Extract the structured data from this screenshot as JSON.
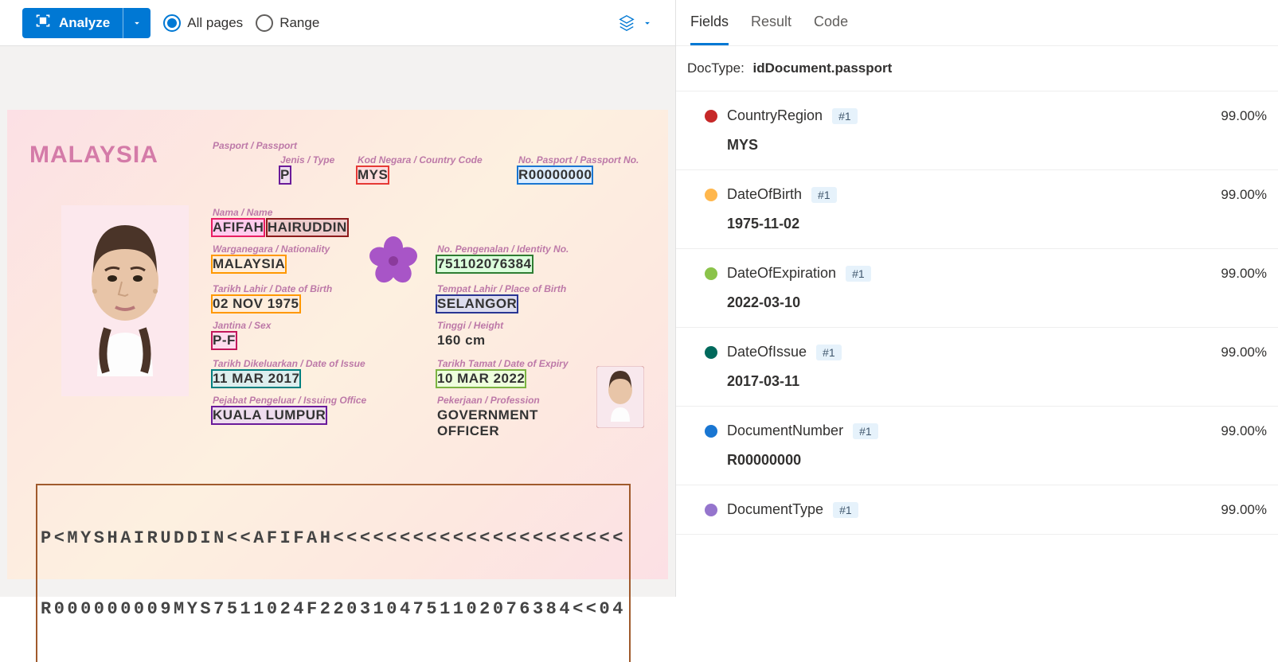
{
  "toolbar": {
    "analyze_label": "Analyze",
    "all_pages_label": "All pages",
    "range_label": "Range"
  },
  "passport": {
    "country_title": "MALAYSIA",
    "labels": {
      "passport": "Pasport / Passport",
      "type": "Jenis / Type",
      "country_code": "Kod Negara / Country Code",
      "passport_no": "No. Pasport / Passport No.",
      "name": "Nama / Name",
      "nationality": "Warganegara / Nationality",
      "identity": "No. Pengenalan / Identity No.",
      "dob": "Tarikh Lahir / Date of Birth",
      "pob": "Tempat Lahir / Place of Birth",
      "sex": "Jantina / Sex",
      "height": "Tinggi / Height",
      "doi": "Tarikh Dikeluarkan / Date of Issue",
      "doe": "Tarikh Tamat / Date of Expiry",
      "office": "Pejabat Pengeluar / Issuing Office",
      "profession": "Pekerjaan / Profession"
    },
    "type_val": "P",
    "country_code_val": "MYS",
    "passport_no_val": "R00000000",
    "first_name": "AFIFAH",
    "last_name": "HAIRUDDIN",
    "nationality": "MALAYSIA",
    "identity_no": "751102076384",
    "dob": "02 NOV 1975",
    "pob": "SELANGOR",
    "sex": "P-F",
    "height": "160 cm",
    "doi": "11 MAR 2017",
    "doe": "10 MAR 2022",
    "office": "KUALA LUMPUR",
    "profession1": "GOVERNMENT",
    "profession2": "OFFICER",
    "mrz1": "P<MYSHAIRUDDIN<<AFIFAH<<<<<<<<<<<<<<<<<<<<<<",
    "mrz2": "R000000009MYS7511024F2203104751102076384<<04"
  },
  "tabs": {
    "fields": "Fields",
    "result": "Result",
    "code": "Code"
  },
  "docType": {
    "label": "DocType:",
    "value": "idDocument.passport"
  },
  "fields": [
    {
      "name": "CountryRegion",
      "badge": "#1",
      "value": "MYS",
      "confidence": "99.00%",
      "color": "#c62828"
    },
    {
      "name": "DateOfBirth",
      "badge": "#1",
      "value": "1975-11-02",
      "confidence": "99.00%",
      "color": "#ffb74d"
    },
    {
      "name": "DateOfExpiration",
      "badge": "#1",
      "value": "2022-03-10",
      "confidence": "99.00%",
      "color": "#8bc34a"
    },
    {
      "name": "DateOfIssue",
      "badge": "#1",
      "value": "2017-03-11",
      "confidence": "99.00%",
      "color": "#00695c"
    },
    {
      "name": "DocumentNumber",
      "badge": "#1",
      "value": "R00000000",
      "confidence": "99.00%",
      "color": "#1976d2"
    },
    {
      "name": "DocumentType",
      "badge": "#1",
      "value": "",
      "confidence": "99.00%",
      "color": "#9575cd"
    }
  ]
}
